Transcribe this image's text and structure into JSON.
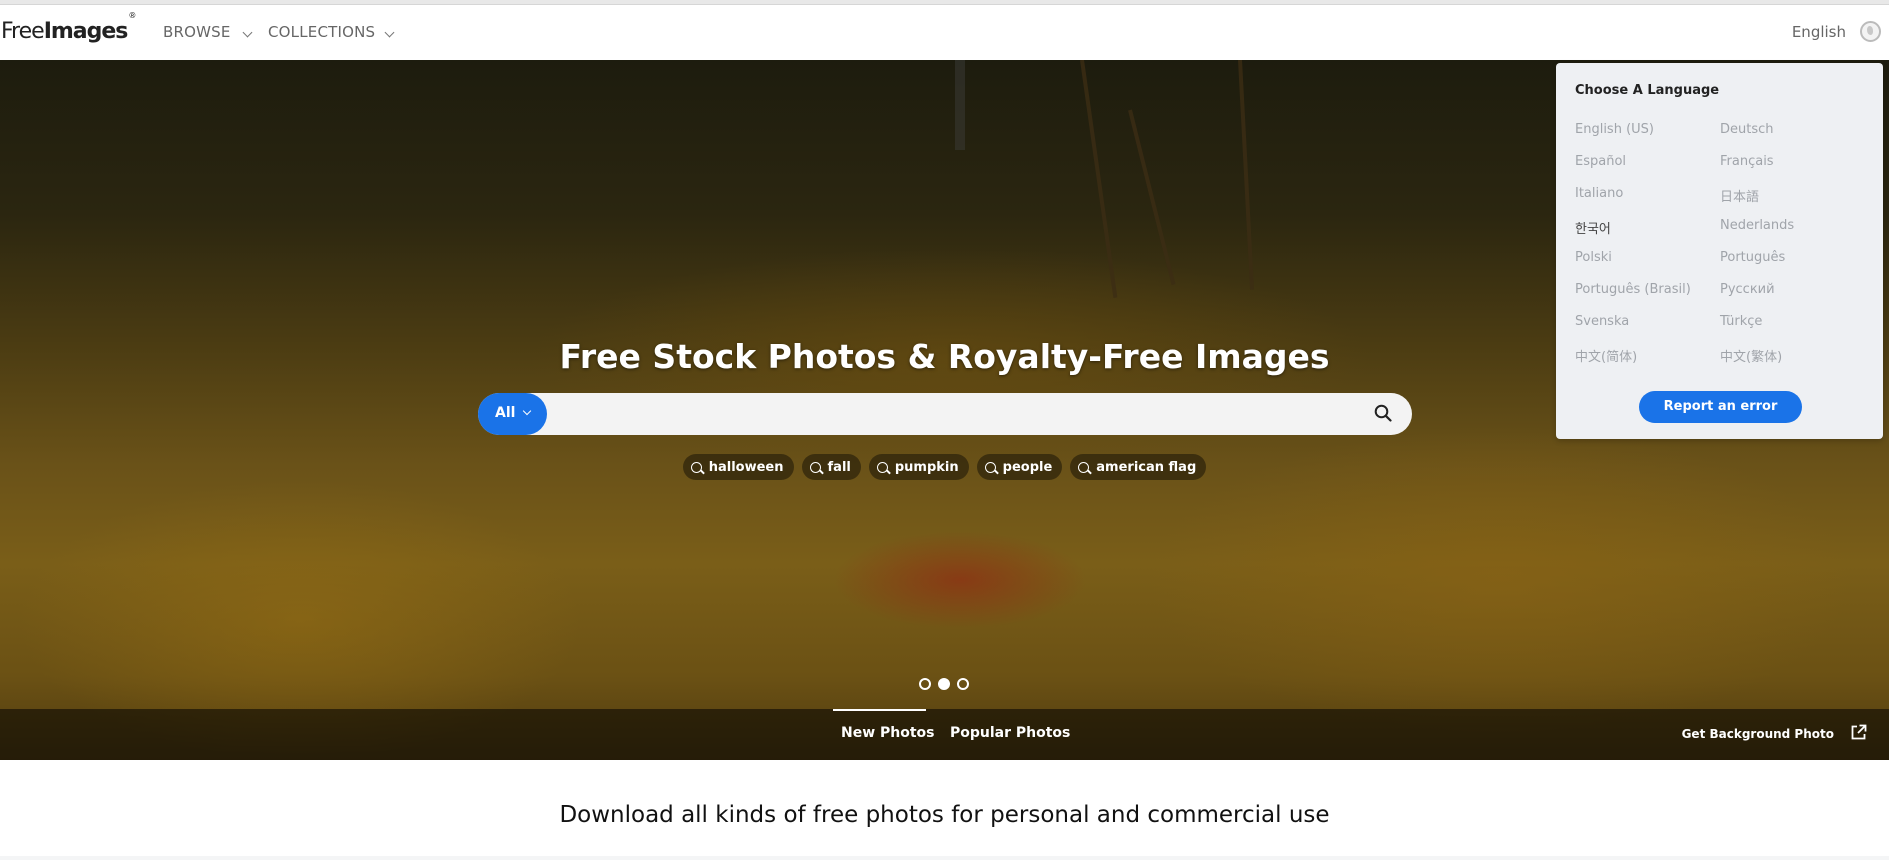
{
  "header": {
    "logo_light": "Free",
    "logo_bold": "Images",
    "logo_mark": "®",
    "nav": [
      {
        "label": "BROWSE"
      },
      {
        "label": "COLLECTIONS"
      }
    ],
    "language": "English"
  },
  "hero": {
    "title": "Free Stock Photos & Royalty-Free Images",
    "search": {
      "filter_label": "All",
      "query": "",
      "placeholder": ""
    },
    "tags": [
      "halloween",
      "fall",
      "pumpkin",
      "people",
      "american flag"
    ],
    "carousel": {
      "count": 3,
      "active_index": 1
    },
    "tabs": [
      {
        "label": "New Photos",
        "active": true
      },
      {
        "label": "Popular Photos",
        "active": false
      }
    ],
    "background_link": "Get Background Photo"
  },
  "language_menu": {
    "title": "Choose A Language",
    "languages": [
      {
        "label": "English (US)",
        "current": false
      },
      {
        "label": "Deutsch",
        "current": false
      },
      {
        "label": "Español",
        "current": false
      },
      {
        "label": "Français",
        "current": false
      },
      {
        "label": "Italiano",
        "current": false
      },
      {
        "label": "日本語",
        "current": false
      },
      {
        "label": "한국어",
        "current": true
      },
      {
        "label": "Nederlands",
        "current": false
      },
      {
        "label": "Polski",
        "current": false
      },
      {
        "label": "Português",
        "current": false
      },
      {
        "label": "Português (Brasil)",
        "current": false
      },
      {
        "label": "Русский",
        "current": false
      },
      {
        "label": "Svenska",
        "current": false
      },
      {
        "label": "Türkçe",
        "current": false
      },
      {
        "label": "中文(简体)",
        "current": false
      },
      {
        "label": "中文(繁体)",
        "current": false
      }
    ],
    "report_label": "Report an error"
  },
  "tagline": "Download all kinds of free photos for personal and commercial use",
  "colors": {
    "accent": "#1a73e8",
    "menu_bg": "#eef0f3"
  }
}
